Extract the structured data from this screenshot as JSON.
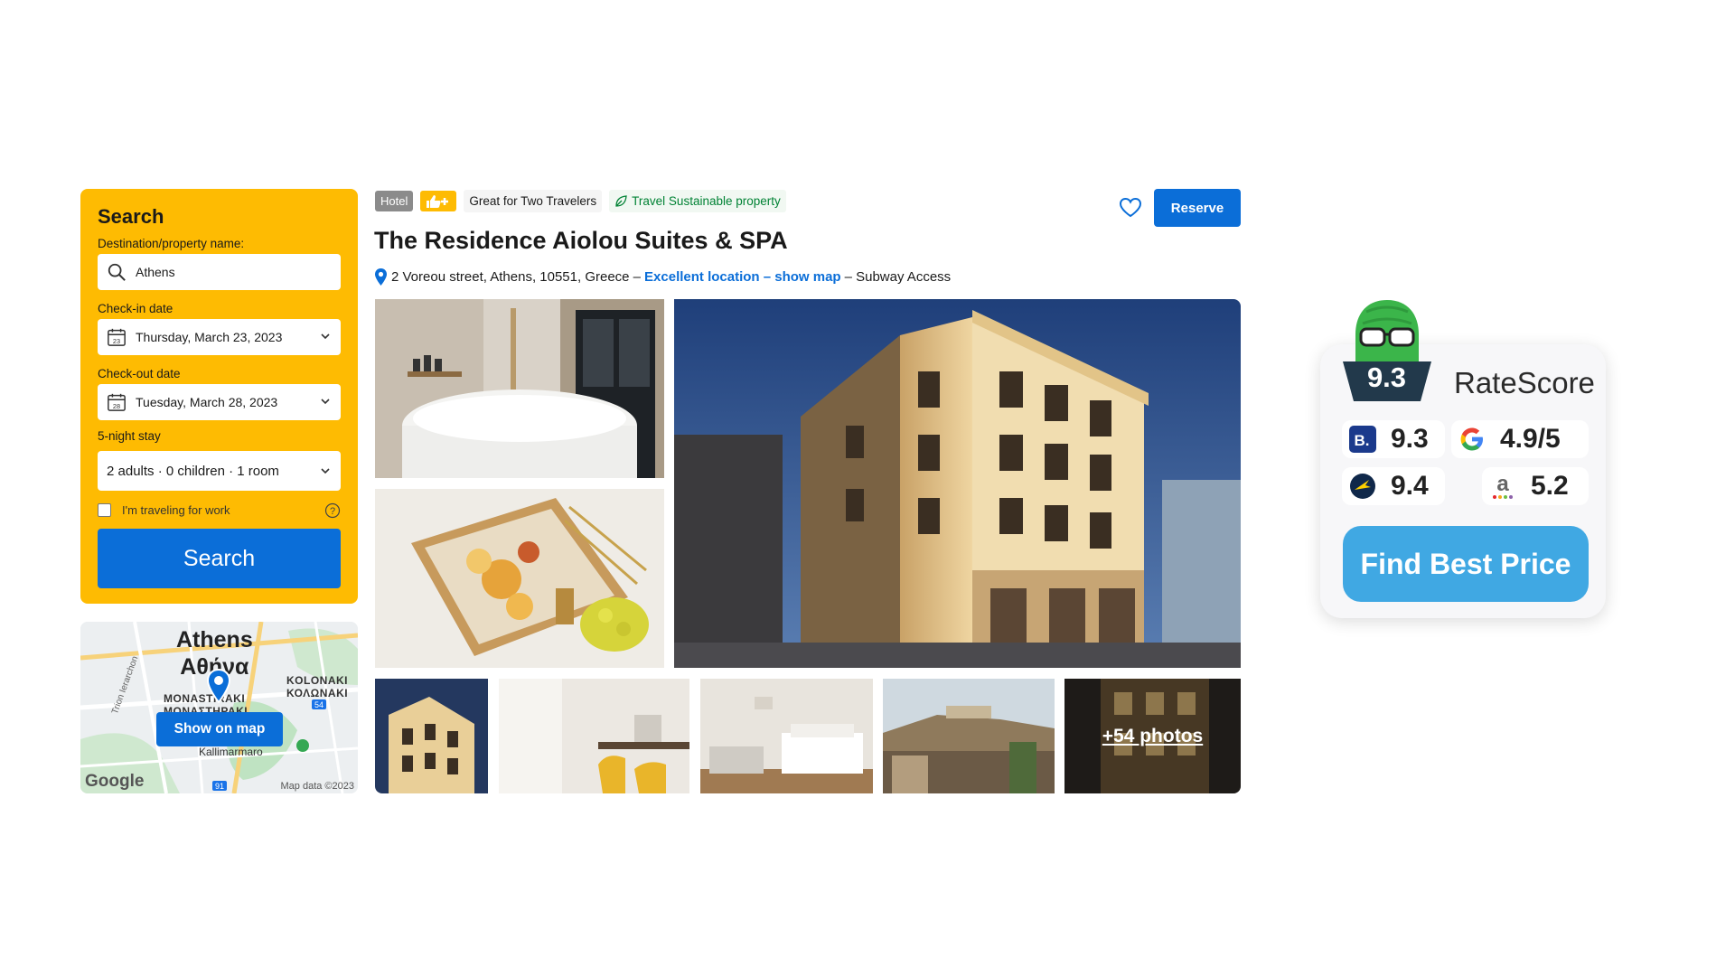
{
  "search": {
    "title": "Search",
    "destination_label": "Destination/property name:",
    "destination_value": "Athens",
    "checkin_label": "Check-in date",
    "checkin_value": "Thursday, March 23, 2023",
    "checkin_icon_day": "23",
    "checkout_label": "Check-out date",
    "checkout_value": "Tuesday, March 28, 2023",
    "checkout_icon_day": "28",
    "stay_label": "5-night stay",
    "guests_value": "2 adults · 0 children · 1 room",
    "work_label": "I'm traveling for work",
    "button_label": "Search"
  },
  "map": {
    "city_en": "Athens",
    "city_gr": "Αθήνα",
    "area1": "MONASTIRAKI",
    "area1_gr": "ΜΟΝΑΣΤΗΡΑΚΙ",
    "area2": "KOLONAKI",
    "area2_gr": "ΚΟΛΩΝΑΚΙ",
    "street": "Trion Ierarchon",
    "place": "Kallimarmaro",
    "road_badge_1": "54",
    "road_badge_2": "91",
    "show_button": "Show on map",
    "google": "Google",
    "map_data": "Map data ©2023"
  },
  "hotel": {
    "badge_type": "Hotel",
    "badge_travelers": "Great for Two Travelers",
    "badge_sustainable": "Travel Sustainable property",
    "title": "The Residence Aiolou Suites & SPA",
    "address": "2 Voreou street, Athens, 10551, Greece –",
    "location_link": "Excellent location – show map",
    "address_suffix": "– Subway Access",
    "reserve_label": "Reserve",
    "more_photos": "+54 photos"
  },
  "ratescore": {
    "score": "9.3",
    "title": "RateScore",
    "booking_logo_letter": "B.",
    "booking": "9.3",
    "google": "4.9/5",
    "expedia": "9.4",
    "agoda_letter": "a",
    "agoda": "5.2",
    "button": "Find Best Price"
  },
  "colors": {
    "search_panel": "#febb02",
    "primary_blue": "#0b6ed8",
    "sustain_green": "#008234",
    "find_price": "#40a8e3",
    "mascot_green": "#3bb54a"
  }
}
